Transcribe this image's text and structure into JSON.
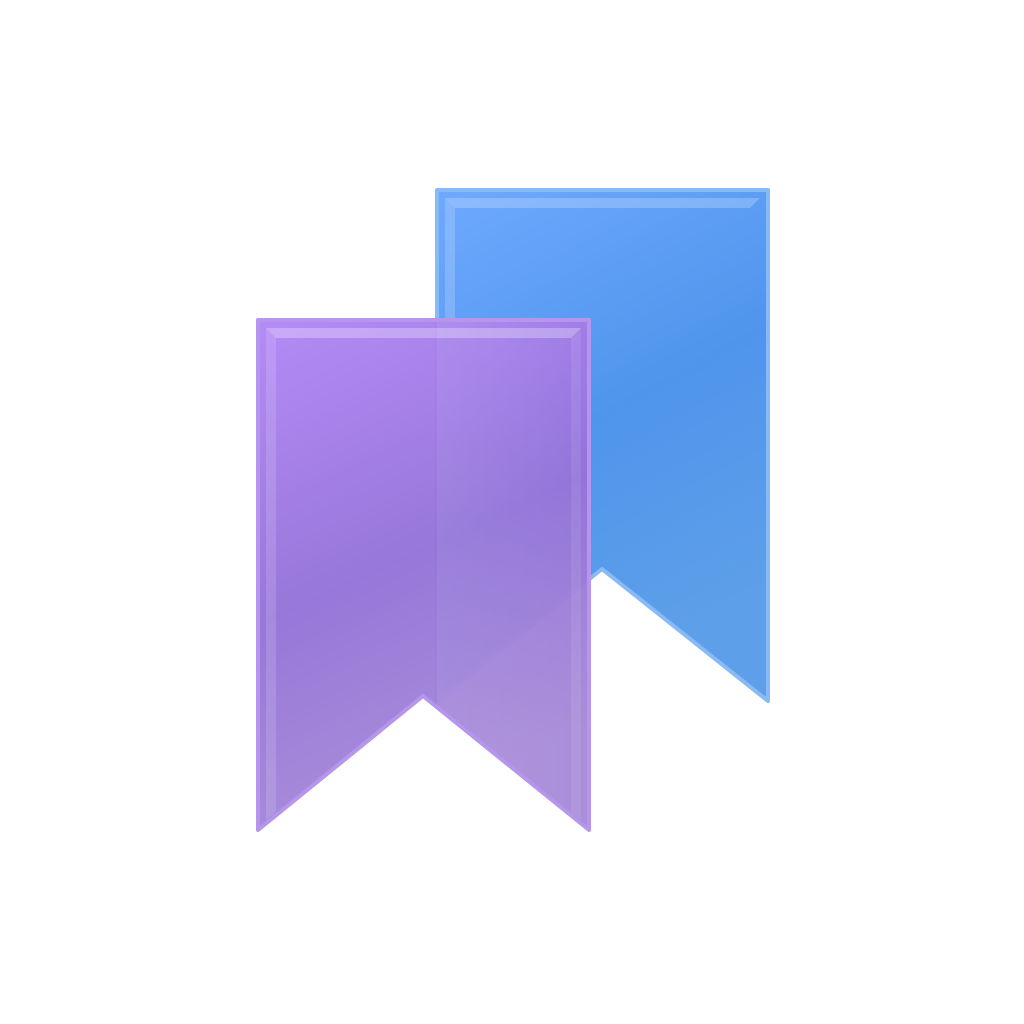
{
  "icon": {
    "name": "bookmarks-icon",
    "bookmarks": [
      {
        "name": "back-bookmark",
        "color_top": "#6aa9ff",
        "color_mid": "#5097ec",
        "color_bottom": "#5a9be6",
        "edge": "#7fb6f7"
      },
      {
        "name": "front-bookmark",
        "color_top": "#b184f5",
        "color_mid": "#9a74dc",
        "color_bottom": "#a185d6",
        "edge": "#b596ee"
      }
    ]
  }
}
